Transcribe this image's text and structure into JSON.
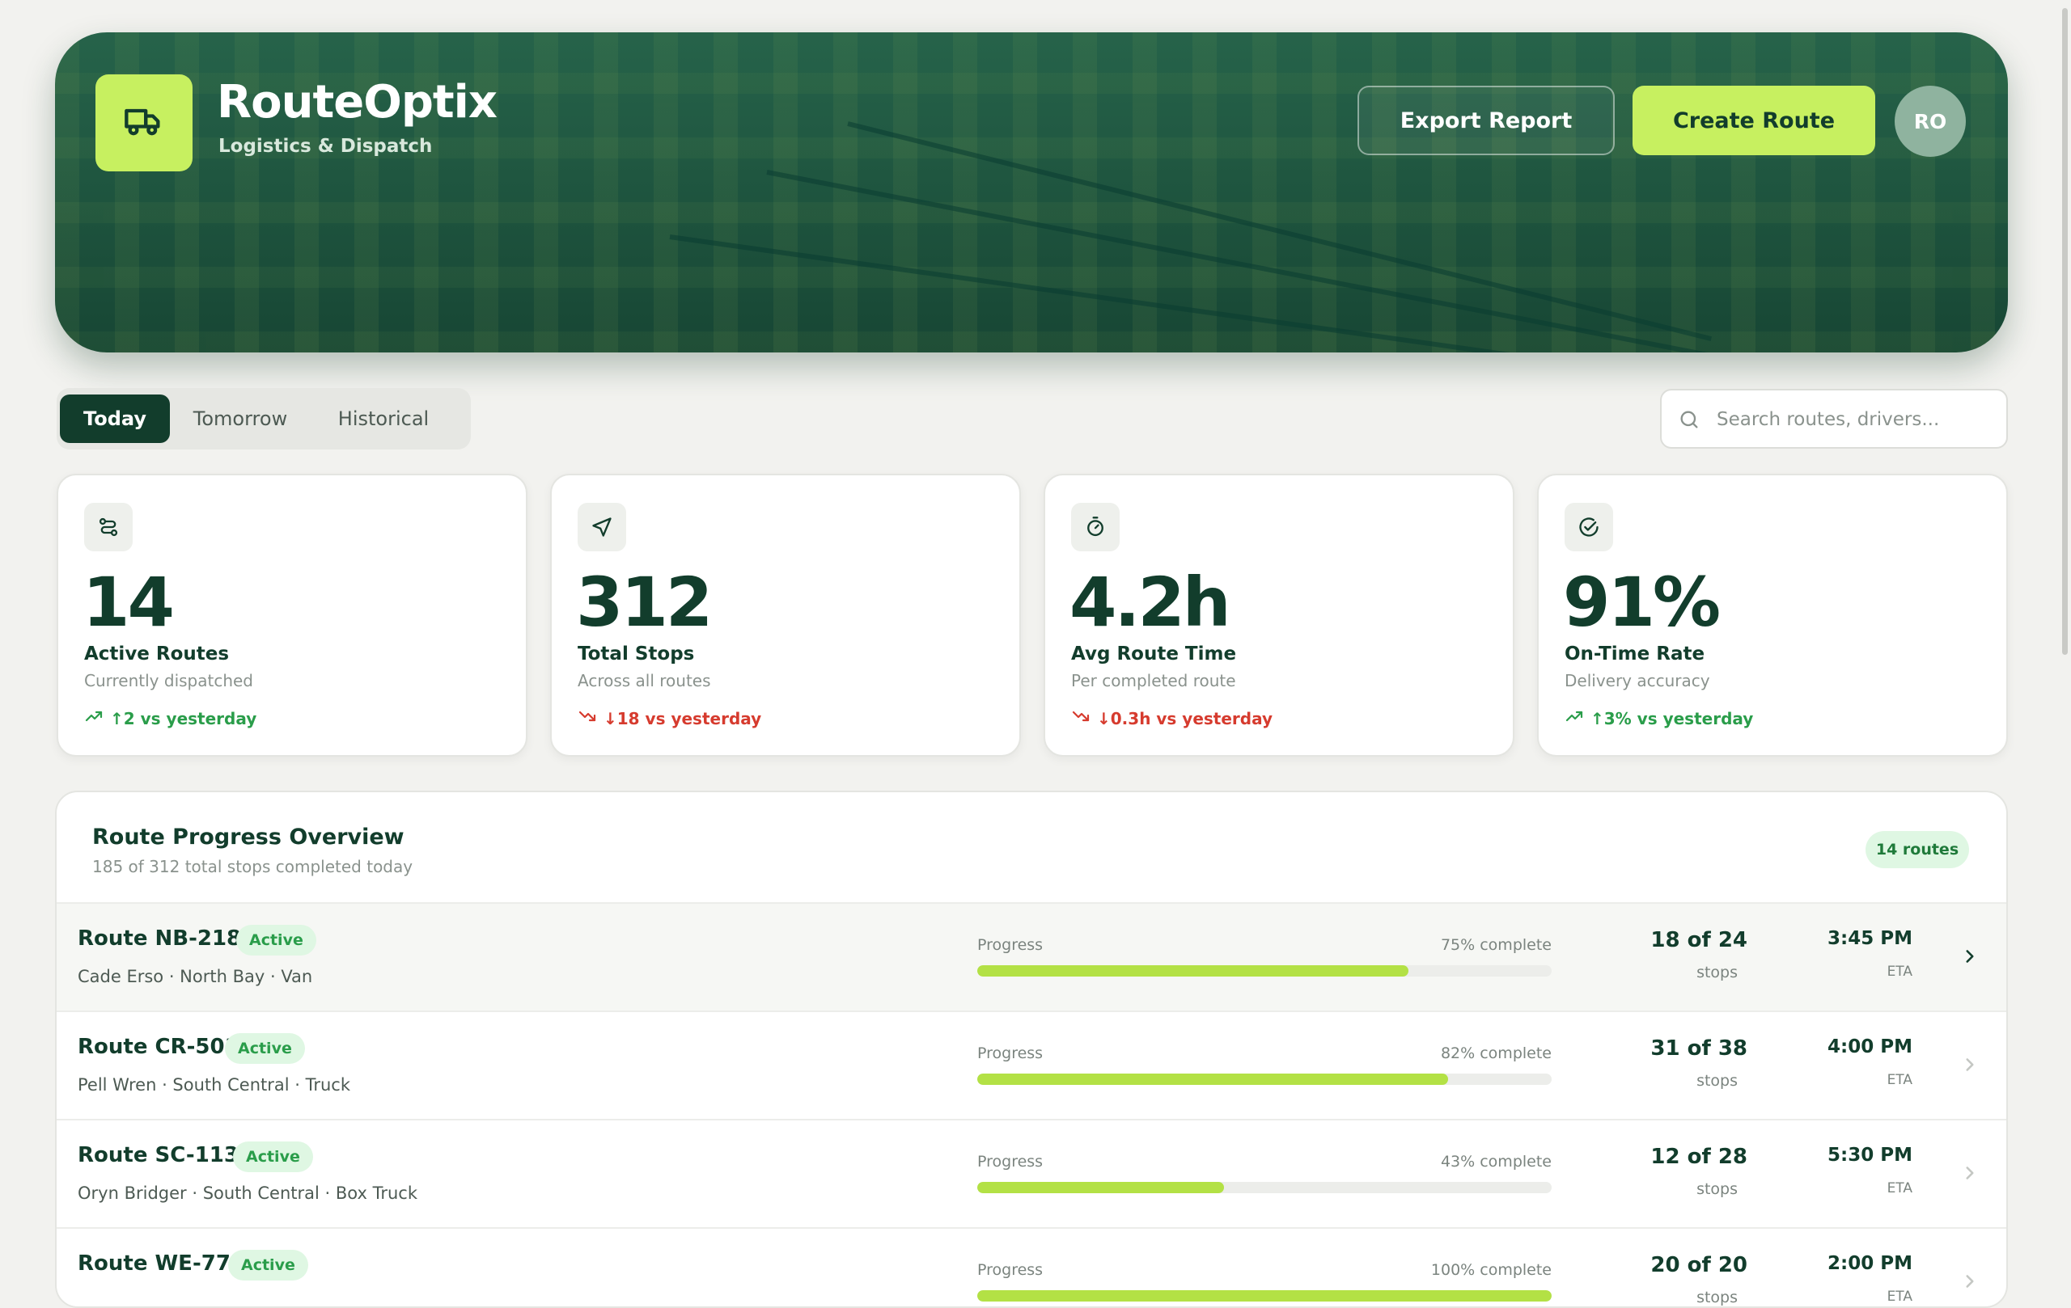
{
  "app": {
    "name": "RouteOptix",
    "tagline": "Logistics & Dispatch",
    "brand_icon": "truck-icon",
    "avatar_initials": "RO"
  },
  "header": {
    "export_label": "Export Report",
    "create_label": "Create Route"
  },
  "tabs": [
    {
      "label": "Today",
      "active": true
    },
    {
      "label": "Tomorrow",
      "active": false
    },
    {
      "label": "Historical",
      "active": false
    }
  ],
  "search": {
    "placeholder": "Search routes, drivers...",
    "value": ""
  },
  "stats": [
    {
      "icon": "route-icon",
      "value": "14",
      "label": "Active Routes",
      "sub": "Currently dispatched",
      "trend": "↑2 vs yesterday",
      "direction": "up"
    },
    {
      "icon": "navigation-icon",
      "value": "312",
      "label": "Total Stops",
      "sub": "Across all routes",
      "trend": "↓18 vs yesterday",
      "direction": "down"
    },
    {
      "icon": "timer-icon",
      "value": "4.2h",
      "label": "Avg Route Time",
      "sub": "Per completed route",
      "trend": "↓0.3h vs yesterday",
      "direction": "down"
    },
    {
      "icon": "check-circle-icon",
      "value": "91%",
      "label": "On-Time Rate",
      "sub": "Delivery accuracy",
      "trend": "↑3% vs yesterday",
      "direction": "up"
    }
  ],
  "overview": {
    "title": "Route Progress Overview",
    "subtitle": "185 of 312 total stops completed today",
    "count_badge": "14 routes",
    "progress_label": "Progress",
    "stops_label": "stops",
    "eta_label": "ETA",
    "routes": [
      {
        "name": "Route NB-2187",
        "status": "Active",
        "meta": "Cade Erso · North Bay · Van",
        "percent": 75,
        "percent_text": "75% complete",
        "stops": "18 of 24",
        "eta": "3:45 PM",
        "highlighted": true
      },
      {
        "name": "Route CR-501",
        "status": "Active",
        "meta": "Pell Wren · South Central · Truck",
        "percent": 82,
        "percent_text": "82% complete",
        "stops": "31 of 38",
        "eta": "4:00 PM",
        "highlighted": false
      },
      {
        "name": "Route SC-1138",
        "status": "Active",
        "meta": "Oryn Bridger · South Central · Box Truck",
        "percent": 43,
        "percent_text": "43% complete",
        "stops": "12 of 28",
        "eta": "5:30 PM",
        "highlighted": false
      },
      {
        "name": "Route WE-774",
        "status": "Active",
        "meta": "",
        "percent": 100,
        "percent_text": "100% complete",
        "stops": "20 of 20",
        "eta": "2:00 PM",
        "highlighted": false
      }
    ]
  },
  "colors": {
    "brand_dark": "#123d2c",
    "accent_lime": "#c7f060",
    "progress_fill": "#b3e145",
    "trend_up": "#2a9d4a",
    "trend_down": "#d63b2e",
    "badge_bg": "#dff7e3"
  }
}
